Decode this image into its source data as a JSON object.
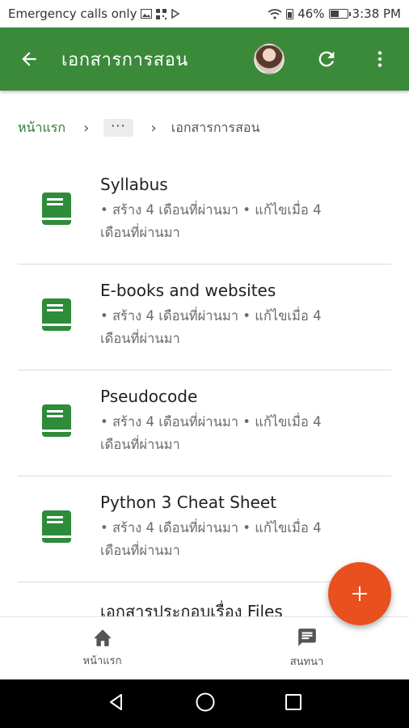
{
  "status_bar": {
    "carrier": "Emergency calls only",
    "battery": "46%",
    "battery_level": 0.46,
    "time": "3:38 PM"
  },
  "app_bar": {
    "title": "เอกสารการสอน",
    "icons": [
      "arrow-back-icon",
      "avatar",
      "refresh-icon",
      "more-vert-icon"
    ]
  },
  "breadcrumb": {
    "home": "หน้าแรก",
    "more": "···",
    "current": "เอกสารการสอน"
  },
  "files": [
    {
      "name": "Syllabus",
      "meta": "• สร้าง 4 เดือนที่ผ่านมา • แก้ไขเมื่อ 4 เดือนที่ผ่านมา"
    },
    {
      "name": "E-books and websites",
      "meta": "• สร้าง 4 เดือนที่ผ่านมา • แก้ไขเมื่อ 4 เดือนที่ผ่านมา"
    },
    {
      "name": "Pseudocode",
      "meta": "• สร้าง 4 เดือนที่ผ่านมา • แก้ไขเมื่อ 4 เดือนที่ผ่านมา"
    },
    {
      "name": "Python 3 Cheat Sheet",
      "meta": "• สร้าง 4 เดือนที่ผ่านมา • แก้ไขเมื่อ 4 เดือนที่ผ่านมา"
    },
    {
      "name": "เอกสารประกอบเรื่อง Files",
      "meta": ""
    }
  ],
  "bottom_nav": {
    "home_label": "หน้าแรก",
    "chat_label": "สนทนา"
  },
  "colors": {
    "app_bar": "#3a8a3a",
    "file_icon": "#2e8b3a",
    "fab": "#e8501f",
    "breadcrumb_home": "#2e7d32"
  }
}
